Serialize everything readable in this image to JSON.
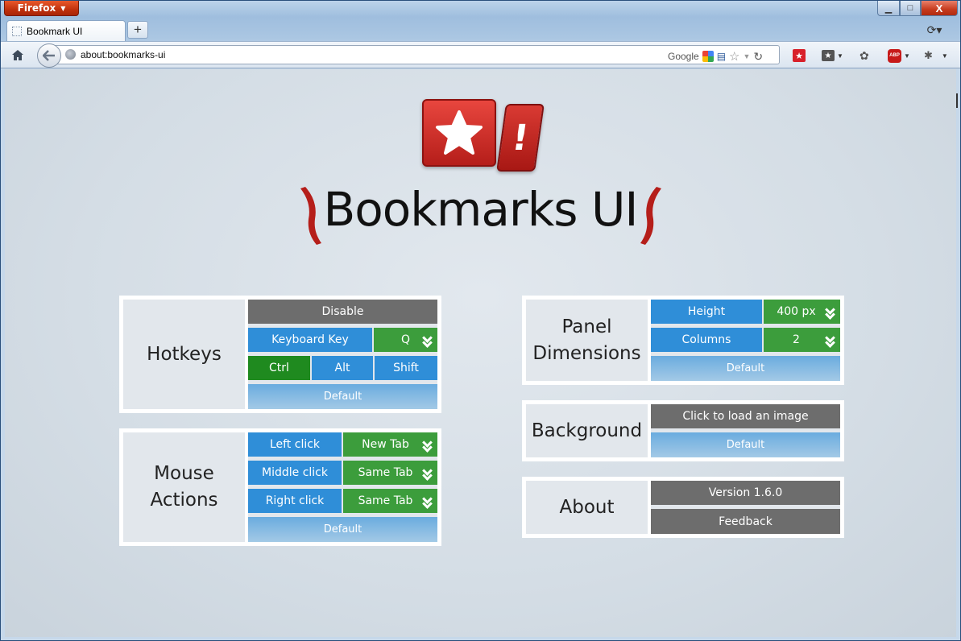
{
  "browser": {
    "menu_button": "Firefox",
    "tab_title": "Bookmark UI",
    "new_tab": "+",
    "url": "about:bookmarks-ui",
    "search_engine": "Google",
    "minimize": "▁",
    "maximize": "□",
    "close": "X"
  },
  "header": {
    "title": "Bookmarks UI",
    "logo_mark": "!"
  },
  "hotkeys": {
    "label": "Hotkeys",
    "disable": "Disable",
    "keyboard_key_label": "Keyboard Key",
    "keyboard_key_value": "Q",
    "ctrl": "Ctrl",
    "alt": "Alt",
    "shift": "Shift",
    "default": "Default"
  },
  "mouse": {
    "label_line1": "Mouse",
    "label_line2": "Actions",
    "rows": [
      {
        "action": "Left click",
        "value": "New Tab"
      },
      {
        "action": "Middle click",
        "value": "Same Tab"
      },
      {
        "action": "Right click",
        "value": "Same Tab"
      }
    ],
    "default": "Default"
  },
  "panel": {
    "label_line1": "Panel",
    "label_line2": "Dimensions",
    "height_label": "Height",
    "height_value": "400 px",
    "columns_label": "Columns",
    "columns_value": "2",
    "default": "Default"
  },
  "background": {
    "label": "Background",
    "load": "Click to load an image",
    "default": "Default"
  },
  "about": {
    "label": "About",
    "version": "Version 1.6.0",
    "feedback": "Feedback"
  },
  "colors": {
    "gray": "#6d6d6d",
    "blue": "#2f8ed8",
    "green": "#3c9d3c",
    "active_green": "#1f8a1f",
    "logo_red": "#c62a24"
  }
}
